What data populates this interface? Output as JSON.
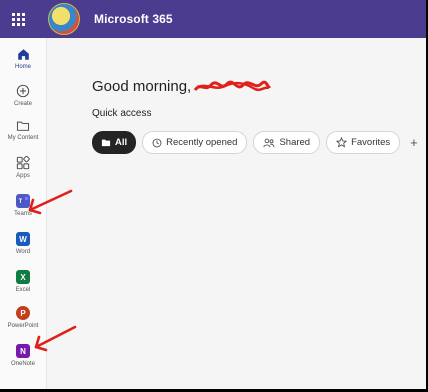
{
  "header": {
    "app_title": "Microsoft 365",
    "waffle_icon": "app-launcher-icon",
    "logo": "organization-logo"
  },
  "sidebar": {
    "items": [
      {
        "label": "Home",
        "icon": "home-icon"
      },
      {
        "label": "Create",
        "icon": "plus-circle-icon"
      },
      {
        "label": "My Content",
        "icon": "folder-icon"
      },
      {
        "label": "Apps",
        "icon": "apps-icon"
      },
      {
        "label": "Teams",
        "icon": "teams-icon"
      },
      {
        "label": "Word",
        "icon": "word-icon"
      },
      {
        "label": "Excel",
        "icon": "excel-icon"
      },
      {
        "label": "PowerPoint",
        "icon": "powerpoint-icon"
      },
      {
        "label": "OneNote",
        "icon": "onenote-icon"
      }
    ]
  },
  "main": {
    "greeting": "Good morning,",
    "quick_access_title": "Quick access",
    "filters": [
      {
        "label": "All",
        "selected": true
      },
      {
        "label": "Recently opened",
        "selected": false
      },
      {
        "label": "Shared",
        "selected": false
      },
      {
        "label": "Favorites",
        "selected": false
      }
    ],
    "add_filter": "+"
  },
  "colors": {
    "topbar": "#4b3c8f",
    "annotation_red": "#e0201b",
    "teams": "#5059c9",
    "word": "#185abd",
    "excel": "#107c41",
    "powerpoint": "#c43e1c",
    "onenote": "#7719aa"
  }
}
